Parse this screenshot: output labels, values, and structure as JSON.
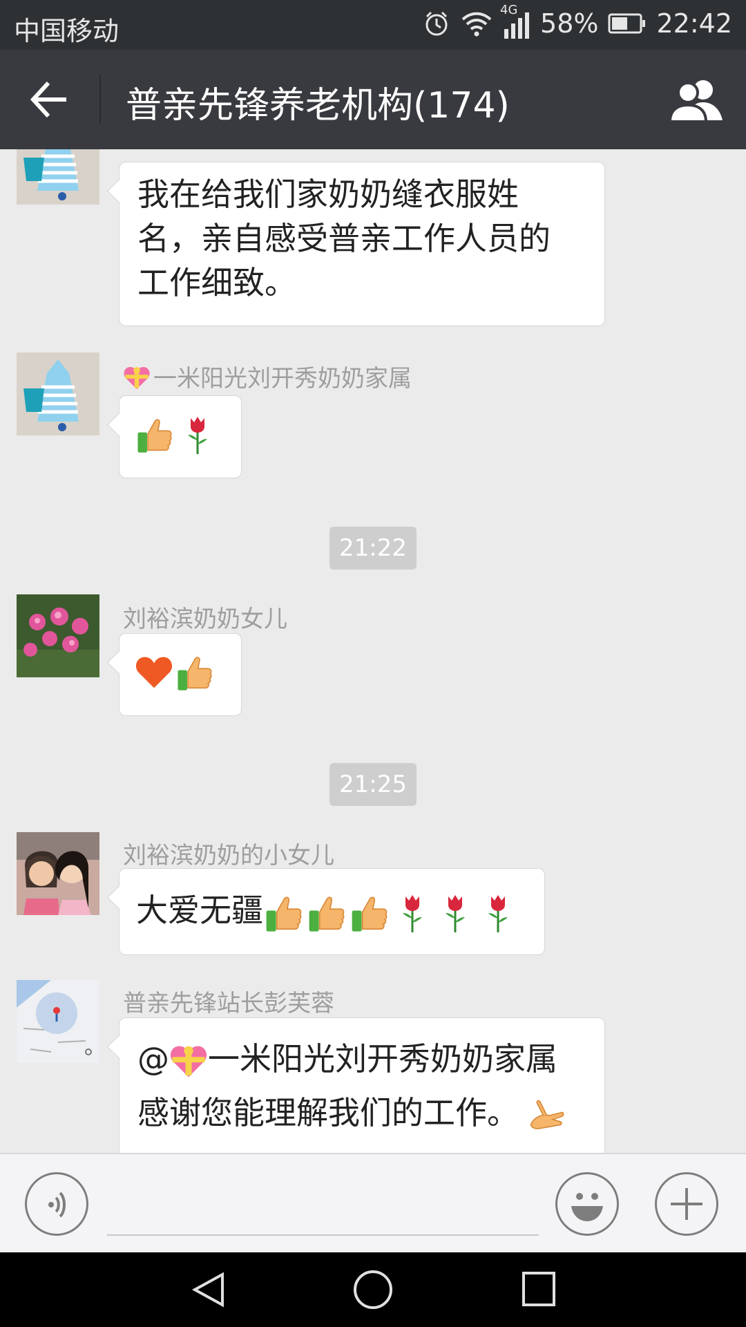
{
  "status_bar": {
    "carrier": "中国移动",
    "network": "4G",
    "battery": "58%",
    "time": "22:42"
  },
  "header": {
    "title": "普亲先锋养老机构(174)"
  },
  "messages": [
    {
      "text_lines": [
        "我在给我们家奶奶缝衣服姓",
        "名，亲自感受普亲工作人员的",
        "工作细致。"
      ]
    },
    {
      "sender": "一米阳光刘开秀奶奶家属"
    },
    {
      "time": "21:22"
    },
    {
      "sender": "刘裕滨奶奶女儿"
    },
    {
      "time": "21:25"
    },
    {
      "sender": "刘裕滨奶奶的小女儿",
      "text": "大爱无疆"
    },
    {
      "sender": "普亲先锋站长彭芙蓉",
      "mention": "@",
      "mention_name": "一米阳光刘开秀奶奶家属",
      "line2": "感谢您能理解我们的工作。"
    }
  ],
  "icons": {
    "back": "arrow-left-icon",
    "group": "group-members-icon",
    "voice": "voice-icon",
    "emoji": "smiley-icon",
    "more": "plus-icon",
    "gift_heart": "gift-heart-emoji",
    "thumbs_up": "thumbs-up-emoji",
    "rose": "rose-emoji",
    "heart": "red-heart-emoji",
    "clap": "ok-hand-emoji"
  },
  "colors": {
    "header_bg": "#393a3f",
    "status_bg": "#2e3134",
    "chat_bg": "#ebebeb",
    "bubble_bg": "#ffffff"
  }
}
